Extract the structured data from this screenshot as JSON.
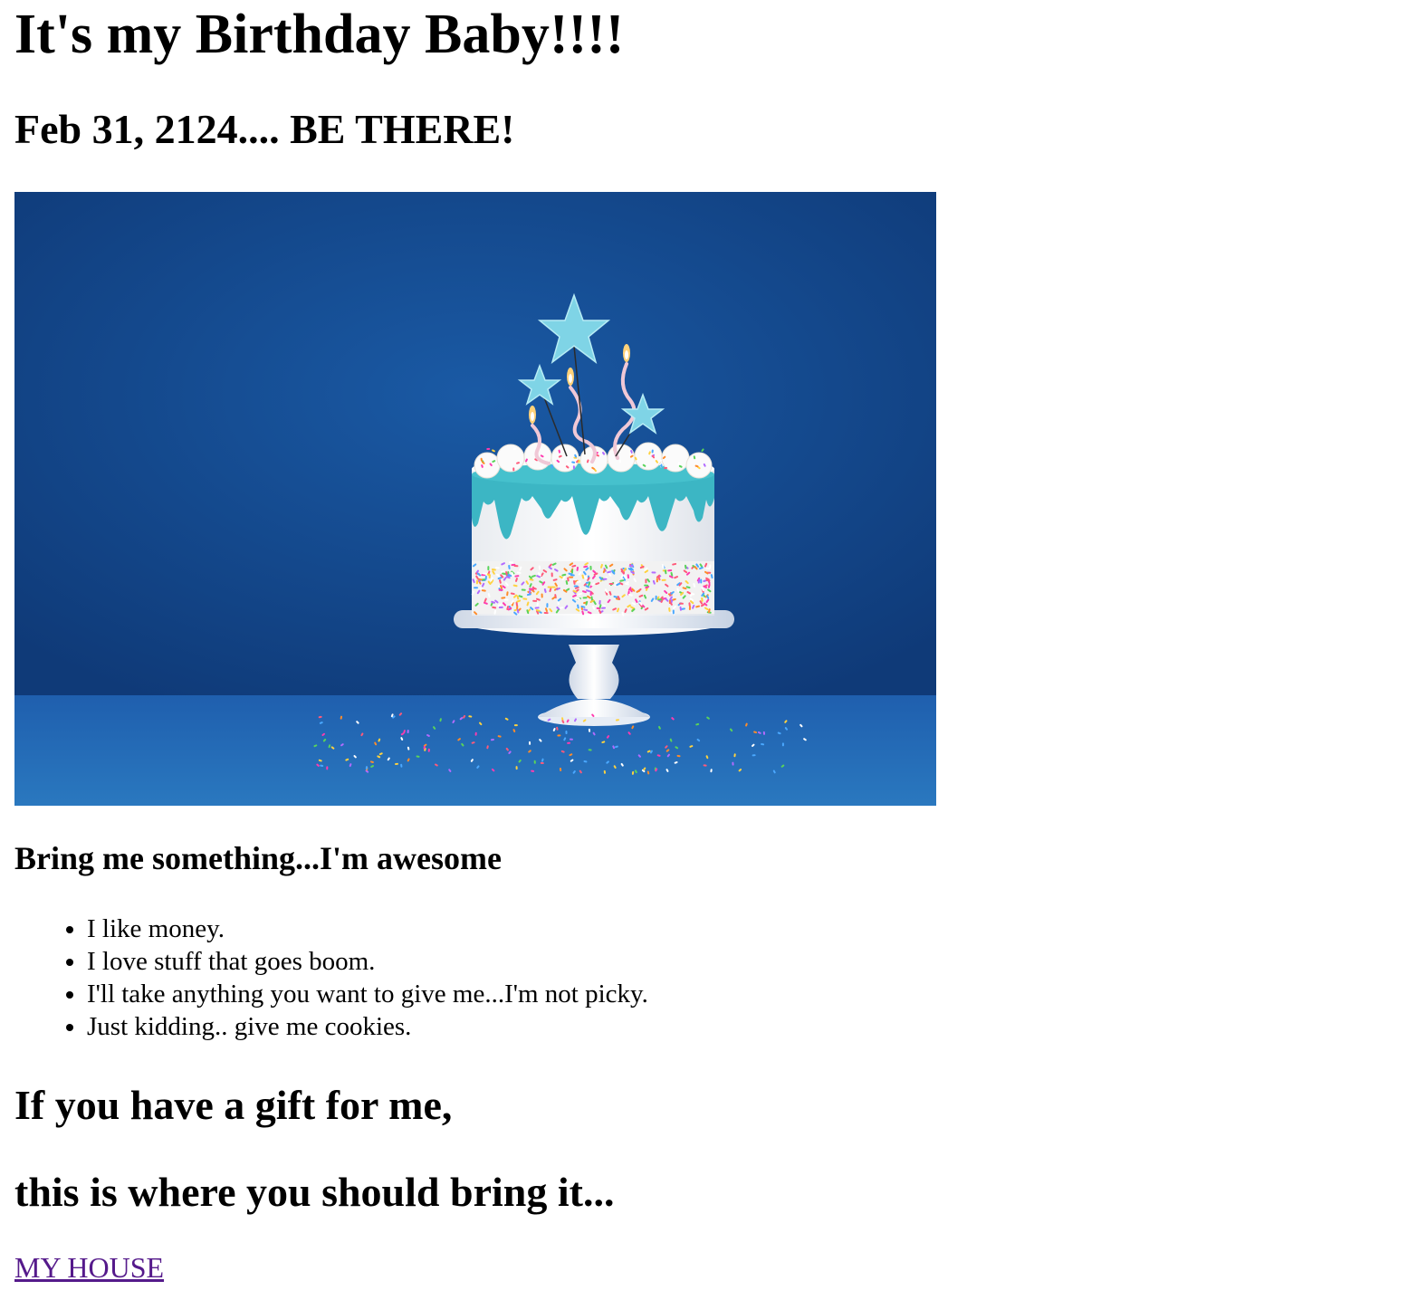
{
  "page": {
    "title": "It's my Birthday Baby!!!!",
    "date_line": "Feb 31, 2124.... BE THERE!",
    "image_alt": "birthday-cake-photo",
    "gift_heading": "Bring me something...I'm awesome",
    "gift_list": [
      "I like money.",
      "I love stuff that goes boom.",
      "I'll take anything you want to give me...I'm not picky.",
      "Just kidding.. give me cookies."
    ],
    "gift_prompt_1": "If you have a gift for me,",
    "gift_prompt_2": "this is where you should bring it...",
    "link_text": "MY HOUSE"
  },
  "colors": {
    "link_visited": "#551a8b",
    "backdrop_blue": "#15488f",
    "icing_teal": "#3cb6c4"
  }
}
